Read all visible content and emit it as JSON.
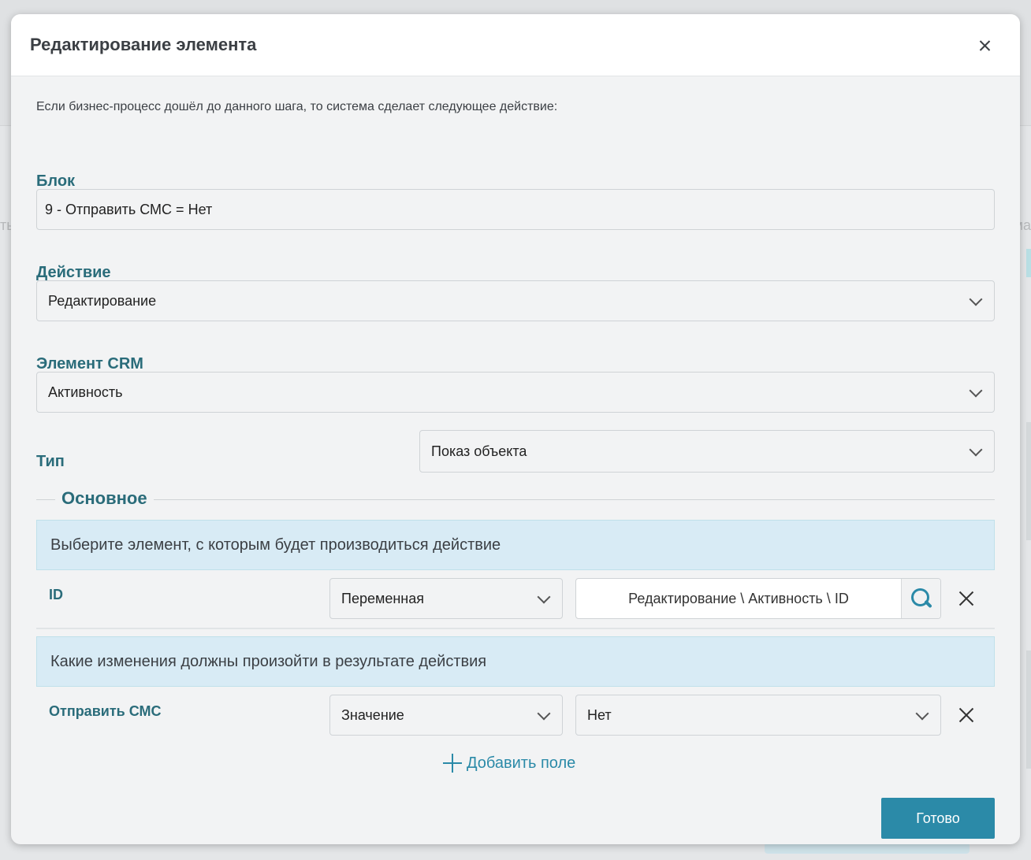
{
  "background": {
    "left_fragment": "ты",
    "right_fragment": "ма"
  },
  "modal": {
    "title": "Редактирование элемента",
    "intro": "Если бизнес-процесс дошёл до данного шага, то система сделает следующее действие:"
  },
  "block": {
    "label": "Блок",
    "value": "9 - Отправить СМС = Нет"
  },
  "action": {
    "label": "Действие",
    "value": "Редактирование"
  },
  "crm_element": {
    "label": "Элемент CRM",
    "value": "Активность"
  },
  "type": {
    "label": "Тип",
    "value": "Показ объекта"
  },
  "section": {
    "title": "Основное"
  },
  "select_banner": {
    "text": "Выберите элемент, с которым будет производиться действие"
  },
  "id_row": {
    "label": "ID",
    "source": "Переменная",
    "value": "Редактирование \\ Активность \\ ID"
  },
  "changes_banner": {
    "text": "Какие изменения должны произойти в результате действия"
  },
  "sms_row": {
    "label": "Отправить СМС",
    "source": "Значение",
    "value": "Нет"
  },
  "add_field": {
    "label": "Добавить поле"
  },
  "done": {
    "label": "Готово"
  },
  "colors": {
    "accent": "#2b8aa8",
    "label": "#2a6c7a",
    "banner": "#d8ebf5"
  }
}
